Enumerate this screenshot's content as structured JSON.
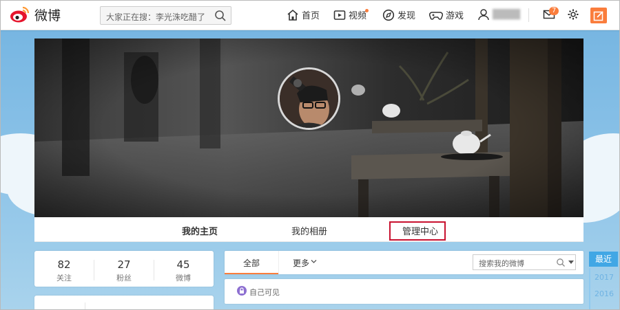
{
  "app": {
    "logo_text": "微博"
  },
  "search": {
    "placeholder": "大家正在搜：李光洙吃醋了"
  },
  "nav": [
    {
      "label": "首页",
      "icon": "home-icon"
    },
    {
      "label": "视频",
      "icon": "video-icon"
    },
    {
      "label": "发现",
      "icon": "discover-icon"
    },
    {
      "label": "游戏",
      "icon": "game-icon"
    }
  ],
  "user": {
    "name": "████",
    "icon": "user-icon"
  },
  "notifications": {
    "count": "7"
  },
  "profile_tabs": [
    {
      "label": "我的主页",
      "active": true
    },
    {
      "label": "我的相册",
      "active": false
    },
    {
      "label": "管理中心",
      "active": false,
      "highlighted": true
    }
  ],
  "stats": [
    {
      "value": "82",
      "label": "关注"
    },
    {
      "value": "27",
      "label": "粉丝"
    },
    {
      "value": "45",
      "label": "微博"
    }
  ],
  "feed": {
    "tabs": [
      {
        "label": "全部"
      },
      {
        "label": "更多"
      }
    ],
    "search_placeholder": "搜索我的微博",
    "visibility_label": "自己可见"
  },
  "timeline": {
    "active": "最近",
    "years": [
      "2017",
      "2016"
    ]
  },
  "colors": {
    "accent": "#fa7d3c",
    "highlight_border": "#c8102e",
    "timeline_blue": "#41a7e5"
  }
}
